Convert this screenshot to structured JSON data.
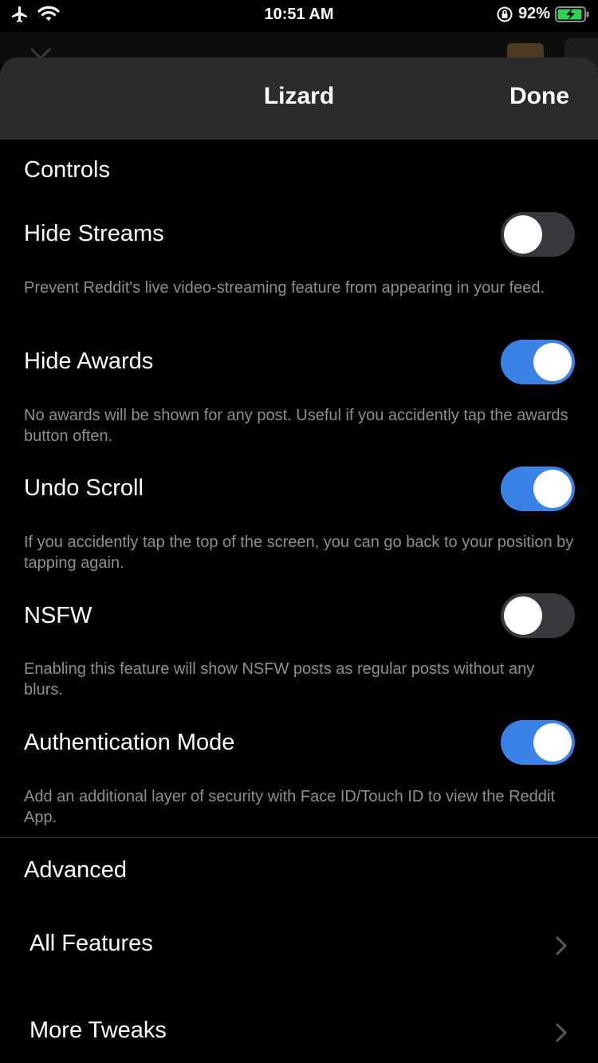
{
  "status_bar": {
    "time": "10:51 AM",
    "battery": "92%",
    "icons": [
      "airplane-icon",
      "wifi-icon",
      "orientation-lock-icon",
      "battery-charging-icon"
    ]
  },
  "nav": {
    "title": "Lizard",
    "done_label": "Done"
  },
  "sections": {
    "controls_header": "Controls",
    "advanced_header": "Advanced"
  },
  "settings": [
    {
      "label": "Hide Streams",
      "description": "Prevent Reddit's live video-streaming feature from appearing in your feed.",
      "enabled": false
    },
    {
      "label": "Hide Awards",
      "description": "No awards will be shown for any post. Useful if you accidently tap the awards button often.",
      "enabled": true
    },
    {
      "label": "Undo Scroll",
      "description": "If you accidently tap the top of the screen, you can go back to your position by tapping again.",
      "enabled": true
    },
    {
      "label": "NSFW",
      "description": "Enabling this feature will show NSFW posts as regular posts without any blurs.",
      "enabled": false
    },
    {
      "label": "Authentication Mode",
      "description": "Add an additional layer of security with Face ID/Touch ID to view the Reddit App.",
      "enabled": true
    }
  ],
  "advanced_items": [
    {
      "label": "All Features"
    },
    {
      "label": "More Tweaks"
    }
  ],
  "colors": {
    "toggle_on": "#3b82e6",
    "toggle_off": "#39393d",
    "nav_background": "#2b2b2b",
    "description_text": "#8e8e93",
    "battery_green": "#30d158"
  }
}
